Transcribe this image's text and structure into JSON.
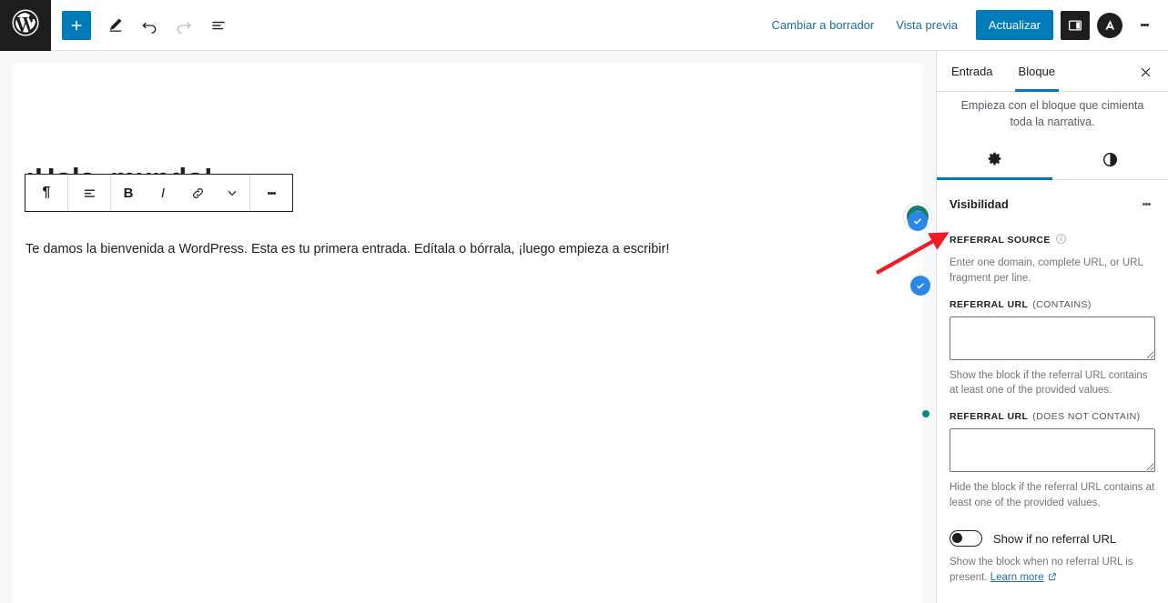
{
  "topbar": {
    "logo_icon": "wordpress-logo-icon",
    "add_block_label": "+",
    "tools": [
      {
        "name": "edit-pencil-icon"
      },
      {
        "name": "undo-icon"
      },
      {
        "name": "redo-icon"
      },
      {
        "name": "document-overview-icon"
      }
    ],
    "switch_to_draft": "Cambiar a borrador",
    "preview": "Vista previa",
    "update": "Actualizar",
    "sidebar_toggle_icon": "sidebar-toggle-icon",
    "avatar_letter": "A",
    "options_icon": "options-ellipsis-icon",
    "accent_color": "#007cba"
  },
  "editor": {
    "post_title": "¡Hola, mundo!",
    "post_body": "Te damos la bienvenida a WordPress. Esta es tu primera entrada. Edítala o bórrala, ¡luego empieza a escribir!",
    "block_toolbar": [
      {
        "name": "paragraph-block-icon",
        "glyph": "¶"
      },
      {
        "name": "align-text-icon",
        "glyph": ""
      },
      {
        "name": "bold-icon",
        "glyph": "B"
      },
      {
        "name": "italic-icon",
        "glyph": "I"
      },
      {
        "name": "link-icon",
        "glyph": ""
      },
      {
        "name": "more-formatting-chevron-icon",
        "glyph": ""
      },
      {
        "name": "block-options-icon",
        "glyph": ""
      }
    ],
    "badges": {
      "grammarly_icon": "grammarly-badge-icon",
      "check_icon": "blue-check-icon",
      "status_dot": "green-status-dot"
    },
    "annotation": {
      "name": "red-arrow-annotation",
      "color": "#ee1c25"
    }
  },
  "sidebar": {
    "tabs": [
      {
        "label": "Entrada",
        "active": false
      },
      {
        "label": "Bloque",
        "active": true
      }
    ],
    "close_icon": "close-icon",
    "block_description": "Empieza con el bloque que cimienta toda la narrativa.",
    "icon_tabs": [
      {
        "name": "settings-gear-icon",
        "active": true
      },
      {
        "name": "styles-contrast-icon",
        "active": false
      }
    ],
    "panel": {
      "title": "Visibilidad",
      "options_icon": "panel-options-icon",
      "referral_source_label": "REFERRAL SOURCE",
      "referral_source_info_icon": "info-icon",
      "referral_source_help": "Enter one domain, complete URL, or URL fragment per line.",
      "fields": [
        {
          "label_strong": "REFERRAL URL",
          "label_soft": "(CONTAINS)",
          "value": "",
          "help": "Show the block if the referral URL contains at least one of the provided values."
        },
        {
          "label_strong": "REFERRAL URL",
          "label_soft": "(DOES NOT CONTAIN)",
          "value": "",
          "help": "Hide the block if the referral URL contains at least one of the provided values."
        }
      ],
      "toggle": {
        "label": "Show if no referral URL",
        "state": "off",
        "help_prefix": "Show the block when no referral URL is present. ",
        "learn_more": "Learn more",
        "external_icon": "external-link-icon"
      }
    }
  }
}
